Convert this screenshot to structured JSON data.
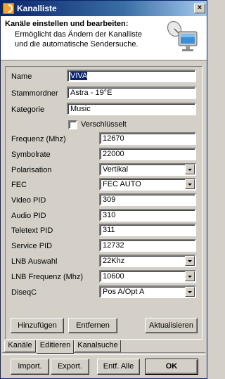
{
  "window": {
    "title": "Kanalliste",
    "close_label": "×"
  },
  "header": {
    "title": "Kanäle einstellen und bearbeiten:",
    "description": "Ermöglicht das Ändern der Kanalliste und die automatische Sendersuche.",
    "icon": "monitor-satellite-icon"
  },
  "form": {
    "name": {
      "label": "Name",
      "value": "VIVA"
    },
    "stammordner": {
      "label": "Stammordner",
      "value": "Astra - 19°E"
    },
    "kategorie": {
      "label": "Kategorie",
      "value": "Music"
    },
    "verschluesselt": {
      "label": "Verschlüsselt",
      "checked": false
    },
    "frequenz": {
      "label": "Frequenz (Mhz)",
      "value": "12670"
    },
    "symbolrate": {
      "label": "Symbolrate",
      "value": "22000"
    },
    "polarisation": {
      "label": "Polarisation",
      "value": "Vertikal"
    },
    "fec": {
      "label": "FEC",
      "value": "FEC AUTO"
    },
    "video_pid": {
      "label": "Video PID",
      "value": "309"
    },
    "audio_pid": {
      "label": "Audio PID",
      "value": "310"
    },
    "teletext_pid": {
      "label": "Teletext PID",
      "value": "311"
    },
    "service_pid": {
      "label": "Service PID",
      "value": "12732"
    },
    "lnb_auswahl": {
      "label": "LNB Auswahl",
      "value": "22Khz"
    },
    "lnb_frequenz": {
      "label": "LNB Frequenz (Mhz)",
      "value": "10600"
    },
    "diseqc": {
      "label": "DiseqC",
      "value": "Pos A/Opt A"
    }
  },
  "actions": {
    "hinzufuegen": "Hinzufügen",
    "entfernen": "Entfernen",
    "aktualisieren": "Aktualisieren"
  },
  "tabs": [
    {
      "label": "Kanäle",
      "active": false
    },
    {
      "label": "Editieren",
      "active": true
    },
    {
      "label": "Kanalsuche",
      "active": false
    }
  ],
  "footer": {
    "import": "Import.",
    "export": "Export.",
    "entf_alle": "Entf. Alle",
    "ok": "OK"
  },
  "colors": {
    "titlebar": "#0a246a",
    "face": "#d4d0c8",
    "selection": "#0a246a"
  }
}
